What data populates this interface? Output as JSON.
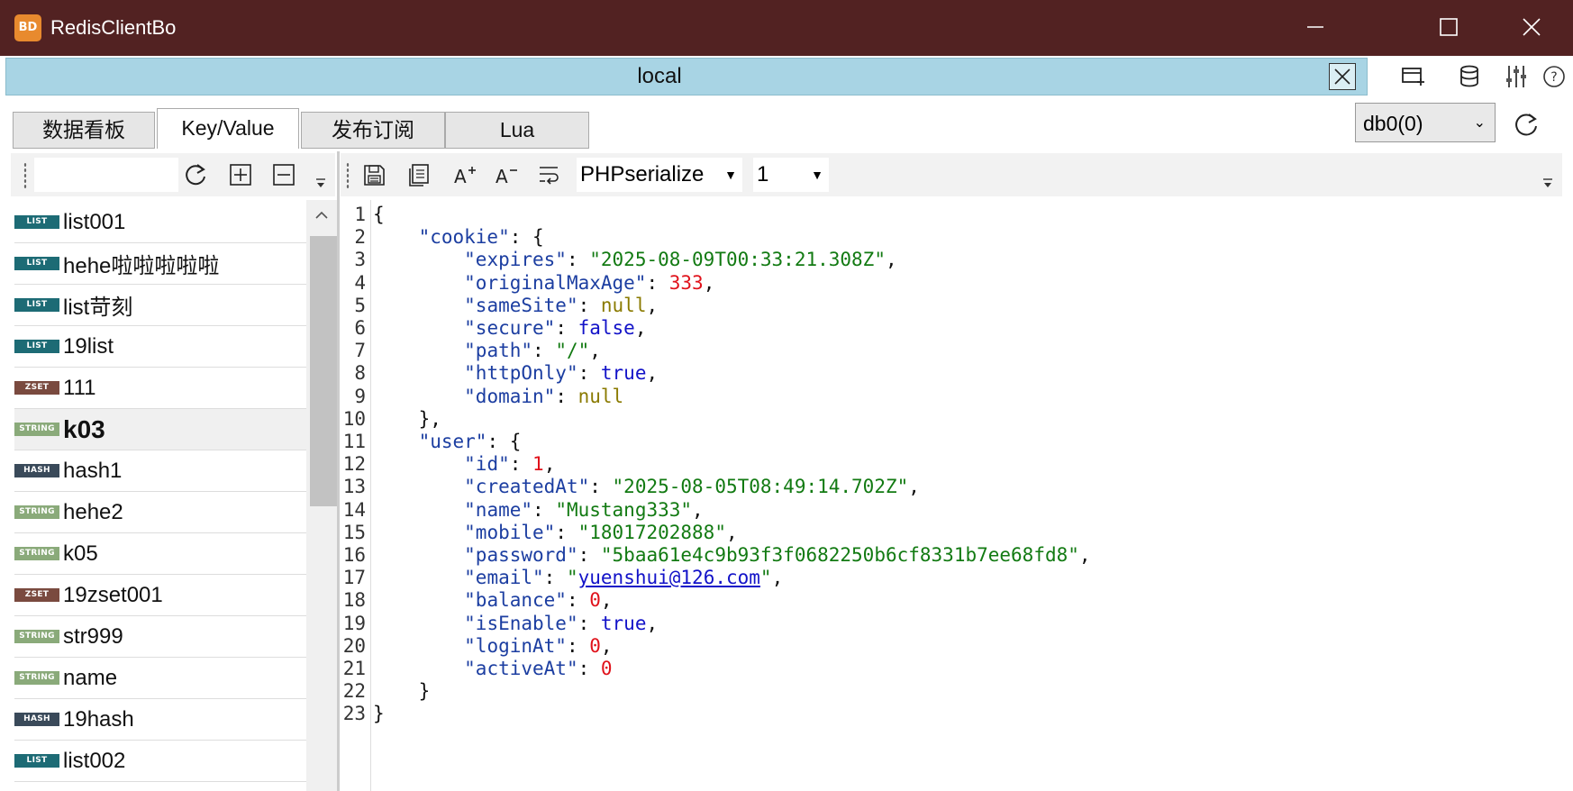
{
  "window": {
    "title": "RedisClientBo",
    "logo_text": "BD"
  },
  "connection": {
    "title": "local"
  },
  "tabs": [
    {
      "label": "数据看板"
    },
    {
      "label": "Key/Value"
    },
    {
      "label": "发布订阅"
    },
    {
      "label": "Lua"
    }
  ],
  "db_selector": {
    "value": "db0(0)"
  },
  "key_search": {
    "value": ""
  },
  "keys": [
    {
      "type": "LIST",
      "name": "list001"
    },
    {
      "type": "LIST",
      "name": "hehe啦啦啦啦啦"
    },
    {
      "type": "LIST",
      "name": "list苛刻"
    },
    {
      "type": "LIST",
      "name": "19list"
    },
    {
      "type": "ZSET",
      "name": "111"
    },
    {
      "type": "STRING",
      "name": "k03"
    },
    {
      "type": "HASH",
      "name": "hash1"
    },
    {
      "type": "STRING",
      "name": "hehe2"
    },
    {
      "type": "STRING",
      "name": "k05"
    },
    {
      "type": "ZSET",
      "name": "19zset001"
    },
    {
      "type": "STRING",
      "name": "str999"
    },
    {
      "type": "STRING",
      "name": "name"
    },
    {
      "type": "HASH",
      "name": "19hash"
    },
    {
      "type": "LIST",
      "name": "list002"
    }
  ],
  "type_colors": {
    "LIST": "#1d6b75",
    "ZSET": "#7a4a3f",
    "STRING": "#8aaa7a",
    "HASH": "#3a4a5a"
  },
  "value_toolbar": {
    "format": "PHPserialize",
    "page": "1"
  },
  "editor": {
    "line_numbers": [
      "1",
      "2",
      "3",
      "4",
      "5",
      "6",
      "7",
      "8",
      "9",
      "10",
      "11",
      "12",
      "13",
      "14",
      "15",
      "16",
      "17",
      "18",
      "19",
      "20",
      "21",
      "22",
      "23"
    ],
    "lines": [
      [
        [
          "p",
          "{"
        ]
      ],
      [
        [
          "p",
          "    "
        ],
        [
          "k",
          "\"cookie\""
        ],
        [
          "p",
          ": {"
        ]
      ],
      [
        [
          "p",
          "        "
        ],
        [
          "k",
          "\"expires\""
        ],
        [
          "p",
          ": "
        ],
        [
          "s",
          "\"2025-08-09T00:33:21.308Z\""
        ],
        [
          "p",
          ","
        ]
      ],
      [
        [
          "p",
          "        "
        ],
        [
          "k",
          "\"originalMaxAge\""
        ],
        [
          "p",
          ": "
        ],
        [
          "n",
          "333"
        ],
        [
          "p",
          ","
        ]
      ],
      [
        [
          "p",
          "        "
        ],
        [
          "k",
          "\"sameSite\""
        ],
        [
          "p",
          ": "
        ],
        [
          "nul",
          "null"
        ],
        [
          "p",
          ","
        ]
      ],
      [
        [
          "p",
          "        "
        ],
        [
          "k",
          "\"secure\""
        ],
        [
          "p",
          ": "
        ],
        [
          "b",
          "false"
        ],
        [
          "p",
          ","
        ]
      ],
      [
        [
          "p",
          "        "
        ],
        [
          "k",
          "\"path\""
        ],
        [
          "p",
          ": "
        ],
        [
          "s",
          "\"/\""
        ],
        [
          "p",
          ","
        ]
      ],
      [
        [
          "p",
          "        "
        ],
        [
          "k",
          "\"httpOnly\""
        ],
        [
          "p",
          ": "
        ],
        [
          "b",
          "true"
        ],
        [
          "p",
          ","
        ]
      ],
      [
        [
          "p",
          "        "
        ],
        [
          "k",
          "\"domain\""
        ],
        [
          "p",
          ": "
        ],
        [
          "nul",
          "null"
        ]
      ],
      [
        [
          "p",
          "    },"
        ]
      ],
      [
        [
          "p",
          "    "
        ],
        [
          "k",
          "\"user\""
        ],
        [
          "p",
          ": {"
        ]
      ],
      [
        [
          "p",
          "        "
        ],
        [
          "k",
          "\"id\""
        ],
        [
          "p",
          ": "
        ],
        [
          "n",
          "1"
        ],
        [
          "p",
          ","
        ]
      ],
      [
        [
          "p",
          "        "
        ],
        [
          "k",
          "\"createdAt\""
        ],
        [
          "p",
          ": "
        ],
        [
          "s",
          "\"2025-08-05T08:49:14.702Z\""
        ],
        [
          "p",
          ","
        ]
      ],
      [
        [
          "p",
          "        "
        ],
        [
          "k",
          "\"name\""
        ],
        [
          "p",
          ": "
        ],
        [
          "s",
          "\"Mustang333\""
        ],
        [
          "p",
          ","
        ]
      ],
      [
        [
          "p",
          "        "
        ],
        [
          "k",
          "\"mobile\""
        ],
        [
          "p",
          ": "
        ],
        [
          "s",
          "\"18017202888\""
        ],
        [
          "p",
          ","
        ]
      ],
      [
        [
          "p",
          "        "
        ],
        [
          "k",
          "\"password\""
        ],
        [
          "p",
          ": "
        ],
        [
          "s",
          "\"5baa61e4c9b93f3f0682250b6cf8331b7ee68fd8\""
        ],
        [
          "p",
          ","
        ]
      ],
      [
        [
          "p",
          "        "
        ],
        [
          "k",
          "\"email\""
        ],
        [
          "p",
          ": "
        ],
        [
          "s",
          "\""
        ],
        [
          "lnk",
          "yuenshui@126.com"
        ],
        [
          "s",
          "\""
        ],
        [
          "p",
          ","
        ]
      ],
      [
        [
          "p",
          "        "
        ],
        [
          "k",
          "\"balance\""
        ],
        [
          "p",
          ": "
        ],
        [
          "n",
          "0"
        ],
        [
          "p",
          ","
        ]
      ],
      [
        [
          "p",
          "        "
        ],
        [
          "k",
          "\"isEnable\""
        ],
        [
          "p",
          ": "
        ],
        [
          "b",
          "true"
        ],
        [
          "p",
          ","
        ]
      ],
      [
        [
          "p",
          "        "
        ],
        [
          "k",
          "\"loginAt\""
        ],
        [
          "p",
          ": "
        ],
        [
          "n",
          "0"
        ],
        [
          "p",
          ","
        ]
      ],
      [
        [
          "p",
          "        "
        ],
        [
          "k",
          "\"activeAt\""
        ],
        [
          "p",
          ": "
        ],
        [
          "n",
          "0"
        ]
      ],
      [
        [
          "p",
          "    }"
        ]
      ],
      [
        [
          "p",
          "}"
        ]
      ]
    ]
  },
  "icons": {
    "minimize": "minimize-icon",
    "maximize": "maximize-icon",
    "close": "close-icon",
    "new_connection": "new-window-icon",
    "database": "database-icon",
    "settings": "sliders-icon",
    "help": "help-icon",
    "refresh": "refresh-icon",
    "add": "add-key-icon",
    "remove": "remove-key-icon",
    "save": "save-icon",
    "copy": "copy-icon",
    "font_increase": "font-increase-icon",
    "font_decrease": "font-decrease-icon",
    "wrap": "word-wrap-icon"
  }
}
